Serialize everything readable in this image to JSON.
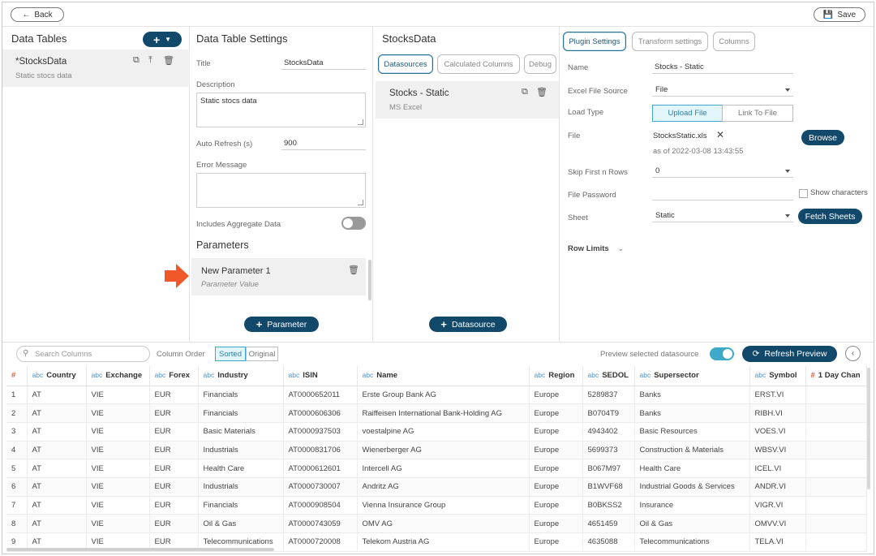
{
  "topbar": {
    "back_label": "Back",
    "save_label": "Save"
  },
  "data_tables": {
    "title": "Data Tables",
    "add_label": "+",
    "items": [
      {
        "name": "*StocksData",
        "description": "Static stocs data"
      }
    ]
  },
  "settings": {
    "title": "Data Table Settings",
    "title_label": "Title",
    "title_value": "StocksData",
    "description_label": "Description",
    "description_value": "Static stocs data",
    "auto_refresh_label": "Auto Refresh (s)",
    "auto_refresh_value": "900",
    "error_label": "Error Message",
    "error_value": "",
    "aggregate_label": "Includes Aggregate Data",
    "parameters_title": "Parameters",
    "parameter": {
      "name": "New Parameter 1",
      "value": "Parameter Value"
    },
    "add_parameter_label": "Parameter"
  },
  "datasource_panel": {
    "title": "StocksData",
    "tabs": [
      "Datasources",
      "Calculated Columns",
      "Debug"
    ],
    "item": {
      "name": "Stocks - Static",
      "type": "MS Excel"
    },
    "add_label": "Datasource"
  },
  "plugin": {
    "tabs": [
      "Plugin Settings",
      "Transform settings",
      "Columns"
    ],
    "name_label": "Name",
    "name_value": "Stocks - Static",
    "source_label": "Excel File Source",
    "source_value": "File",
    "load_type_label": "Load Type",
    "load_options": [
      "Upload File",
      "Link To File"
    ],
    "file_label": "File",
    "file_name": "StocksStatic.xls",
    "file_date": "as of 2022-03-08 13:43:55",
    "browse_label": "Browse",
    "skip_label": "Skip First n Rows",
    "skip_value": "0",
    "password_label": "File Password",
    "show_chars_label": "Show characters",
    "sheet_label": "Sheet",
    "sheet_value": "Static",
    "fetch_label": "Fetch Sheets",
    "row_limits_label": "Row Limits"
  },
  "grid_toolbar": {
    "search_placeholder": "Search Columns",
    "order_label": "Column Order",
    "sorted_label": "Sorted",
    "original_label": "Original",
    "preview_label": "Preview selected datasource",
    "refresh_label": "Refresh Preview"
  },
  "grid": {
    "columns": [
      "Country",
      "Exchange",
      "Forex",
      "Industry",
      "ISIN",
      "Name",
      "Region",
      "SEDOL",
      "Supersector",
      "Symbol",
      "1 Day Chan"
    ],
    "rows": [
      [
        "1",
        "AT",
        "VIE",
        "EUR",
        "Financials",
        "AT0000652011",
        "Erste Group Bank AG",
        "Europe",
        "5289837",
        "Banks",
        "ERST.VI",
        ""
      ],
      [
        "2",
        "AT",
        "VIE",
        "EUR",
        "Financials",
        "AT0000606306",
        "Raiffeisen International Bank-Holding AG",
        "Europe",
        "B0704T9",
        "Banks",
        "RIBH.VI",
        ""
      ],
      [
        "3",
        "AT",
        "VIE",
        "EUR",
        "Basic Materials",
        "AT0000937503",
        "voestalpine AG",
        "Europe",
        "4943402",
        "Basic Resources",
        "VOES.VI",
        ""
      ],
      [
        "4",
        "AT",
        "VIE",
        "EUR",
        "Industrials",
        "AT0000831706",
        "Wienerberger AG",
        "Europe",
        "5699373",
        "Construction & Materials",
        "WBSV.VI",
        ""
      ],
      [
        "5",
        "AT",
        "VIE",
        "EUR",
        "Health Care",
        "AT0000612601",
        "Intercell AG",
        "Europe",
        "B067M97",
        "Health Care",
        "ICEL.VI",
        ""
      ],
      [
        "6",
        "AT",
        "VIE",
        "EUR",
        "Industrials",
        "AT0000730007",
        "Andritz AG",
        "Europe",
        "B1WVF68",
        "Industrial Goods & Services",
        "ANDR.VI",
        ""
      ],
      [
        "7",
        "AT",
        "VIE",
        "EUR",
        "Financials",
        "AT0000908504",
        "Vienna Insurance Group",
        "Europe",
        "B0BKSS2",
        "Insurance",
        "VIGR.VI",
        ""
      ],
      [
        "8",
        "AT",
        "VIE",
        "EUR",
        "Oil & Gas",
        "AT0000743059",
        "OMV AG",
        "Europe",
        "4651459",
        "Oil & Gas",
        "OMVV.VI",
        ""
      ],
      [
        "9",
        "AT",
        "VIE",
        "EUR",
        "Telecommunications",
        "AT0000720008",
        "Telekom Austria AG",
        "Europe",
        "4635088",
        "Telecommunications",
        "TELA.VI",
        ""
      ]
    ]
  },
  "colors": {
    "accent": "#12486a",
    "highlight": "#3fa9c9",
    "arrow": "#f0582a"
  }
}
